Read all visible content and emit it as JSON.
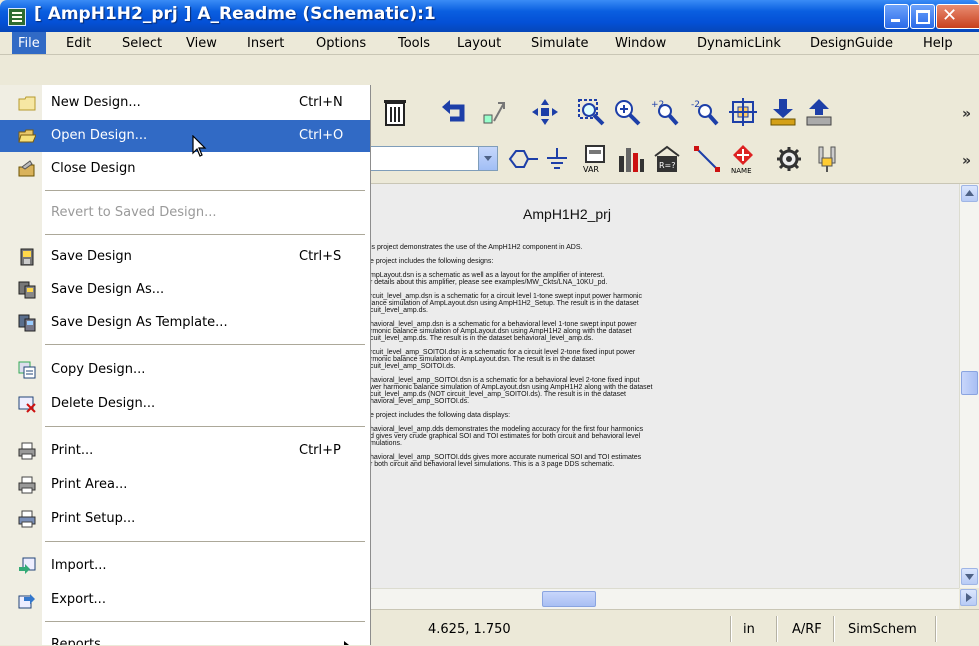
{
  "window": {
    "title": "[ AmpH1H2_prj ] A_Readme (Schematic):1",
    "min_icon": "minimize-icon",
    "max_icon": "maximize-icon",
    "close_icon": "close-icon"
  },
  "menubar": [
    "File",
    "Edit",
    "Select",
    "View",
    "Insert",
    "Options",
    "Tools",
    "Layout",
    "Simulate",
    "Window",
    "DynamicLink",
    "DesignGuide",
    "Help"
  ],
  "file_menu": [
    {
      "label": "New Design...",
      "shortcut": "Ctrl+N",
      "icon": "new-design-icon"
    },
    {
      "label": "Open Design...",
      "shortcut": "Ctrl+O",
      "icon": "open-folder-icon"
    },
    {
      "label": "Close Design",
      "shortcut": "",
      "icon": "close-design-icon"
    },
    {
      "label": "Revert to Saved Design...",
      "shortcut": "",
      "icon": ""
    },
    {
      "label": "Save Design",
      "shortcut": "Ctrl+S",
      "icon": "save-icon"
    },
    {
      "label": "Save Design As...",
      "shortcut": "",
      "icon": "save-as-icon"
    },
    {
      "label": "Save Design As Template...",
      "shortcut": "",
      "icon": "save-template-icon"
    },
    {
      "label": "Copy Design...",
      "shortcut": "",
      "icon": "copy-design-icon"
    },
    {
      "label": "Delete Design...",
      "shortcut": "",
      "icon": "delete-design-icon"
    },
    {
      "label": "Print...",
      "shortcut": "Ctrl+P",
      "icon": "print-icon"
    },
    {
      "label": "Print Area...",
      "shortcut": "",
      "icon": "print-area-icon"
    },
    {
      "label": "Print Setup...",
      "shortcut": "",
      "icon": "print-setup-icon"
    },
    {
      "label": "Import...",
      "shortcut": "",
      "icon": "import-icon"
    },
    {
      "label": "Export...",
      "shortcut": "",
      "icon": "export-icon"
    },
    {
      "label": "Reports",
      "shortcut": "",
      "icon": ""
    }
  ],
  "toolbar2": {
    "var_label": "VAR",
    "name_label": "NAME",
    "eqn_label": "R=?"
  },
  "document": {
    "title": "AmpH1H2_prj",
    "paragraphs": [
      "is project demonstrates the use of the AmpH1H2 component in ADS.",
      "e project includes the following designs:",
      "mpLayout.dsn is a schematic as well as a layout for the amplifier of interest.\nr details about this amplifier, please see examples/MW_Ckts/LNA_10KU_pd.",
      "rcuit_level_amp.dsn is a schematic for a circuit level 1-tone swept input power harmonic\nlance simulation of AmpLayout.dsn using AmpH1H2_Setup. The result is in the dataset\ncuit_level_amp.ds.",
      "havioral_level_amp.dsn is a schematic for a behavioral level 1-tone swept input power\nrmonic balance simulation of AmpLayout.dsn using AmpH1H2 along with the dataset\ncuit_level_amp.ds. The result is in the dataset behavioral_level_amp.ds.",
      "rcuit_level_amp_SOITOI.dsn is a schematic for a circuit level 2-tone fixed input power\nrmonic balance simulation of AmpLayout.dsn. The result is in the dataset\ncuit_level_amp_SOITOI.ds.",
      "havioral_level_amp_SOITOI.dsn is a schematic for a behavioral level 2-tone fixed input\nwer harmonic balance simulation of AmpLayout.dsn using AmpH1H2 along with the dataset\ncuit_level_amp.ds (NOT circuit_level_amp_SOITOI.ds). The result is in the dataset\nhavioral_level_amp_SOITOI.ds.",
      "e project includes the following data displays:",
      "havioral_level_amp.dds demonstrates the modeling accuracy for the first four harmonics\nd gives very crude graphical SOI and TOI estimates for both circuit and behavioral level\nmulations.",
      "havioral_level_amp_SOITOI.dds gives more accurate numerical SOI and TOI estimates\nr both circuit and behavioral level simulations. This is a 3 page DDS schematic."
    ]
  },
  "status": {
    "coords": "4.625, 1.750",
    "units": "in",
    "tech": "A/RF",
    "mode": "SimSchem"
  },
  "colors": {
    "highlight": "#316ac5",
    "titlebar": "#0a5fe0"
  }
}
